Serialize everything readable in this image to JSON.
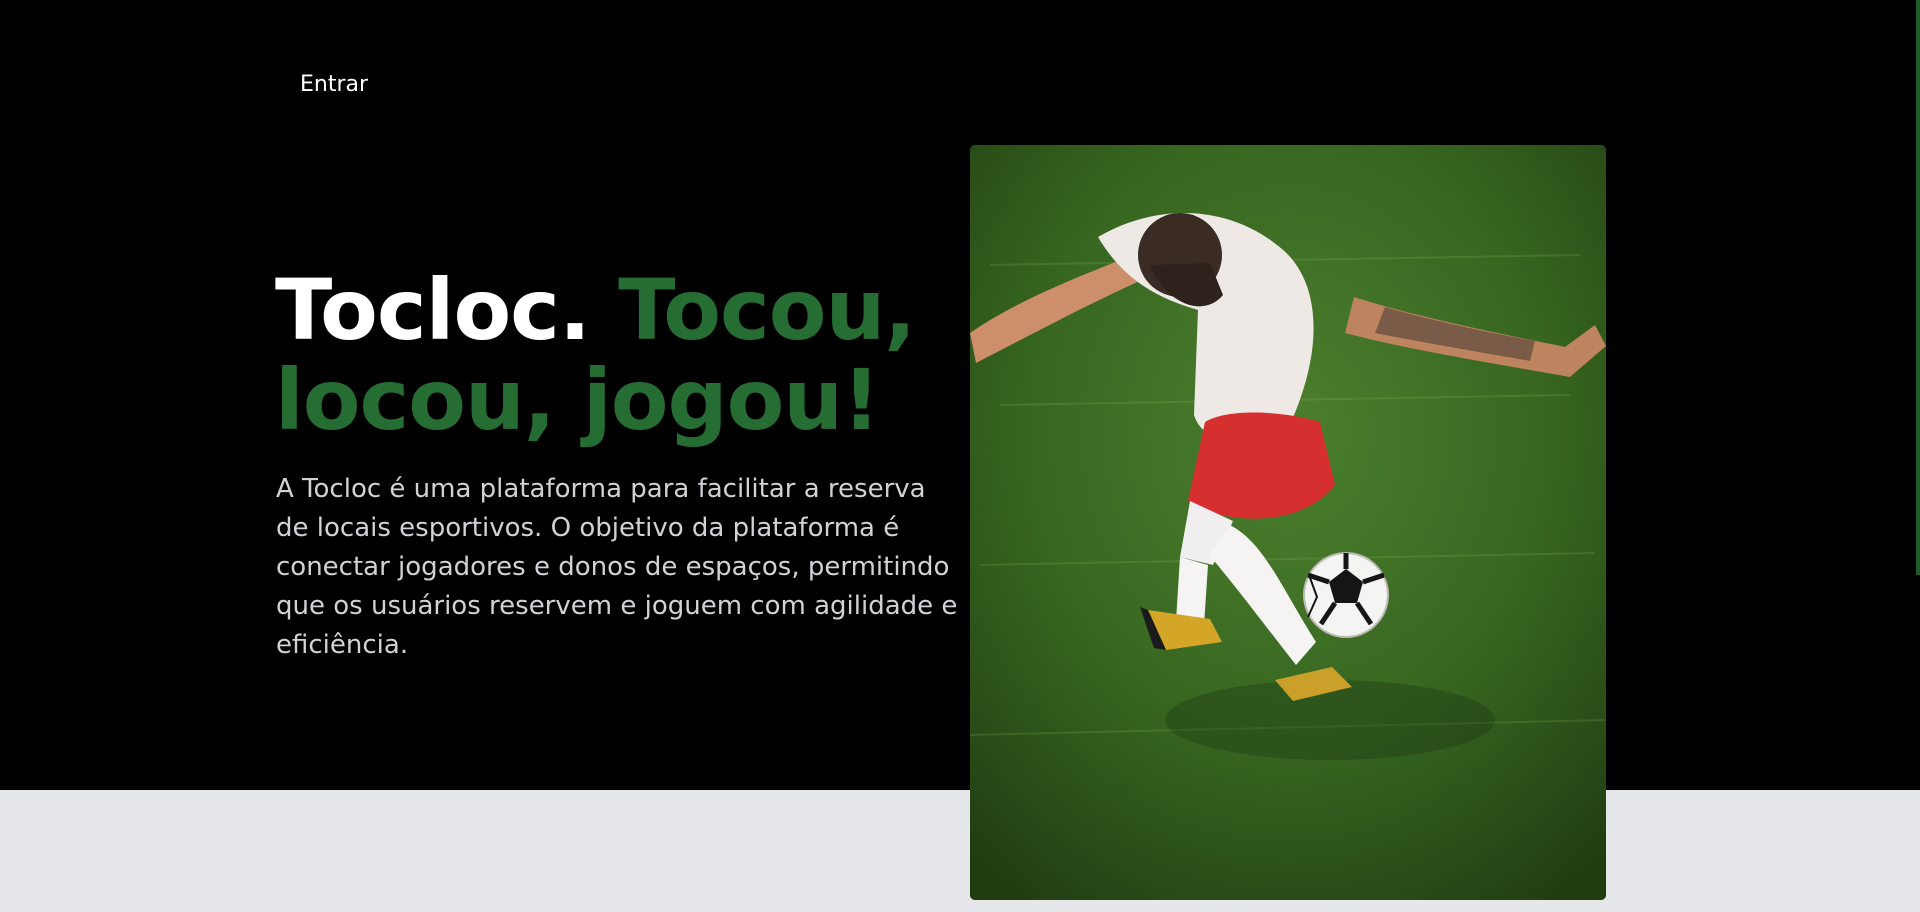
{
  "nav": {
    "login_label": "Entrar"
  },
  "hero": {
    "brand": "Tocloc.",
    "tagline": "Tocou, locou, jogou!",
    "description": "A Tocloc é uma plataforma para facilitar a reserva de locais esportivos. O objetivo da plataforma é conectar jogadores e donos de espaços, permitindo que os usuários reservem e joguem com agilidade e eficiência."
  },
  "image": {
    "subject": "soccer-player-with-ball-on-grass"
  },
  "colors": {
    "background": "#000000",
    "accent_green": "#256d32",
    "text_light": "#d0d2d5",
    "lower_band": "#e6e7ea"
  }
}
